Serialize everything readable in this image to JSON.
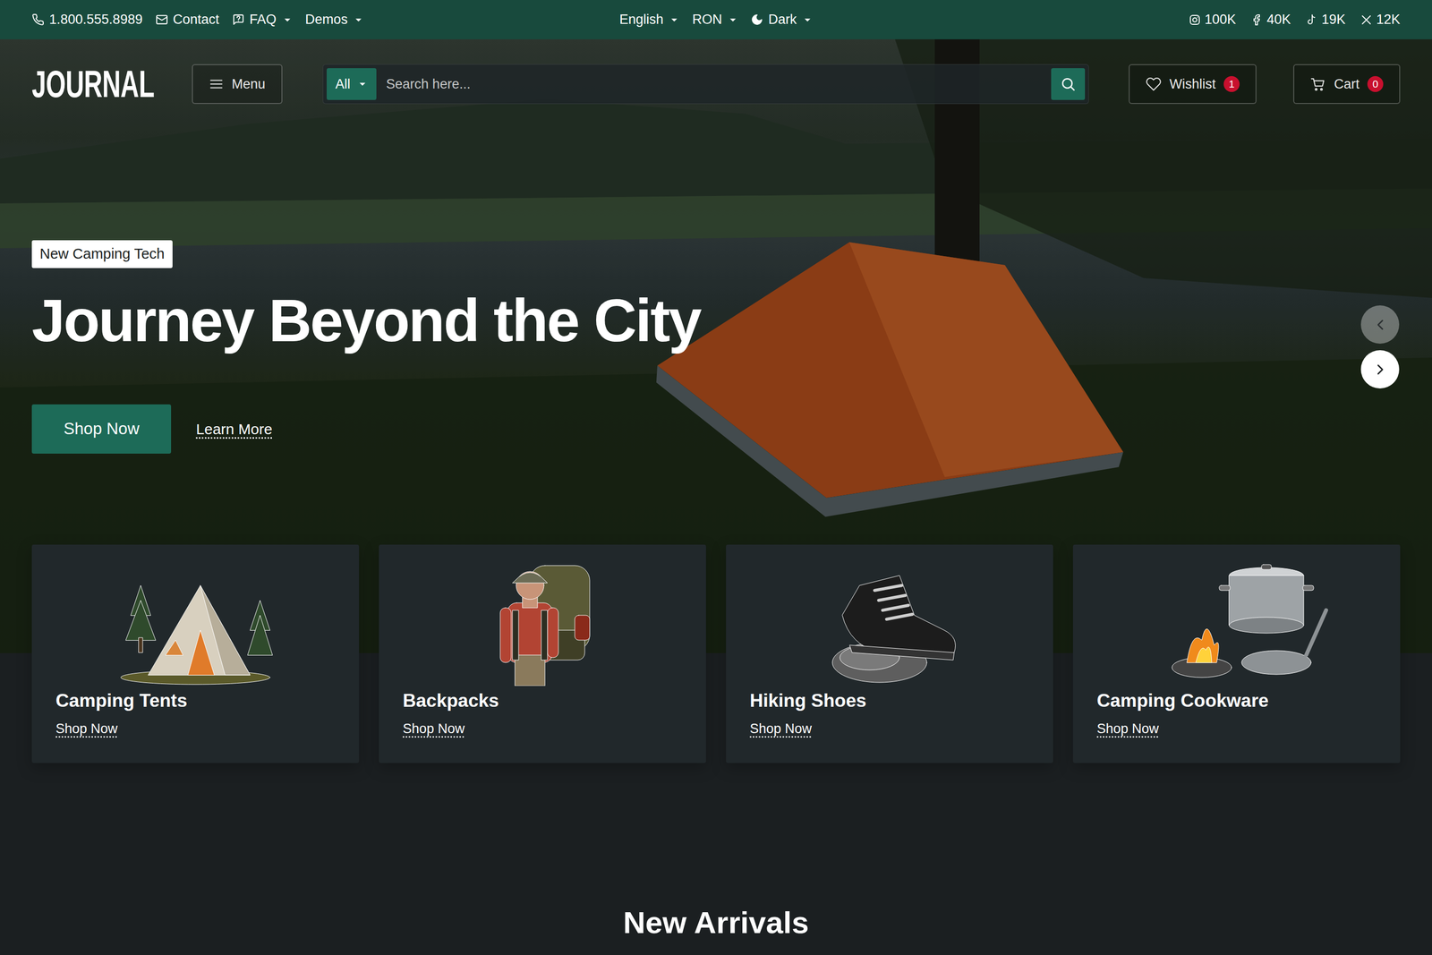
{
  "topbar": {
    "contacts": [
      {
        "kind": "phone",
        "label": "1.800.555.8989",
        "dropdown": false
      },
      {
        "kind": "mail",
        "label": "Contact",
        "dropdown": false
      },
      {
        "kind": "help",
        "label": "FAQ",
        "dropdown": true
      },
      {
        "kind": "none",
        "label": "Demos",
        "dropdown": true
      }
    ],
    "settings": [
      {
        "kind": "none",
        "label": "English",
        "dropdown": true
      },
      {
        "kind": "none",
        "label": "RON",
        "dropdown": true
      },
      {
        "kind": "moon",
        "label": "Dark",
        "dropdown": true
      }
    ],
    "social": [
      {
        "kind": "instagram",
        "count": "100K"
      },
      {
        "kind": "facebook",
        "count": "40K"
      },
      {
        "kind": "tiktok",
        "count": "19K"
      },
      {
        "kind": "x",
        "count": "12K"
      }
    ]
  },
  "header": {
    "logo": "JOURNAL",
    "menu": "Menu",
    "search": {
      "category": "All",
      "placeholder": "Search here..."
    },
    "wishlist": {
      "label": "Wishlist",
      "count": "1"
    },
    "cart": {
      "label": "Cart",
      "count": "0"
    }
  },
  "hero": {
    "badge": "New Camping Tech",
    "title": "Journey Beyond the City",
    "primary": "Shop Now",
    "secondary": "Learn More",
    "carousel": {
      "prev_disabled": true,
      "next_disabled": false
    }
  },
  "categories": [
    {
      "kind": "tent",
      "title": "Camping Tents",
      "link": "Shop Now"
    },
    {
      "kind": "backpack",
      "title": "Backpacks",
      "link": "Shop Now"
    },
    {
      "kind": "boot",
      "title": "Hiking Shoes",
      "link": "Shop Now"
    },
    {
      "kind": "cookware",
      "title": "Camping Cookware",
      "link": "Shop Now"
    }
  ],
  "section": {
    "title": "New Arrivals"
  }
}
